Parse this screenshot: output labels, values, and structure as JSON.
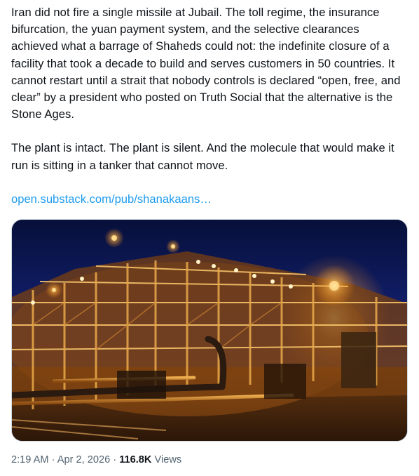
{
  "tweet": {
    "paragraphs": [
      "Iran did not fire a single missile at Jubail. The toll regime, the insurance bifurcation, the yuan payment system, and the selective clearances achieved what a barrage of Shaheds could not: the indefinite closure of a facility that took a decade to build and serves customers in 50 countries. It cannot restart until a strait that nobody controls is declared “open, free, and clear” by a president who posted on Truth Social that the alternative is the Stone Ages.",
      "The plant is intact. The plant is silent. And the molecule that would make it run is sitting in a tanker that cannot move."
    ],
    "link_text": "open.substack.com/pub/shanakaans…",
    "time": "2:19 AM",
    "separator": "·",
    "date": "Apr 2, 2026",
    "views_count": "116.8K",
    "views_label": "Views"
  },
  "colors": {
    "text": "#0f1419",
    "link": "#1d9bf0",
    "secondary": "#536471"
  },
  "media": {
    "type": "photo",
    "subject": "industrial plant at night"
  }
}
